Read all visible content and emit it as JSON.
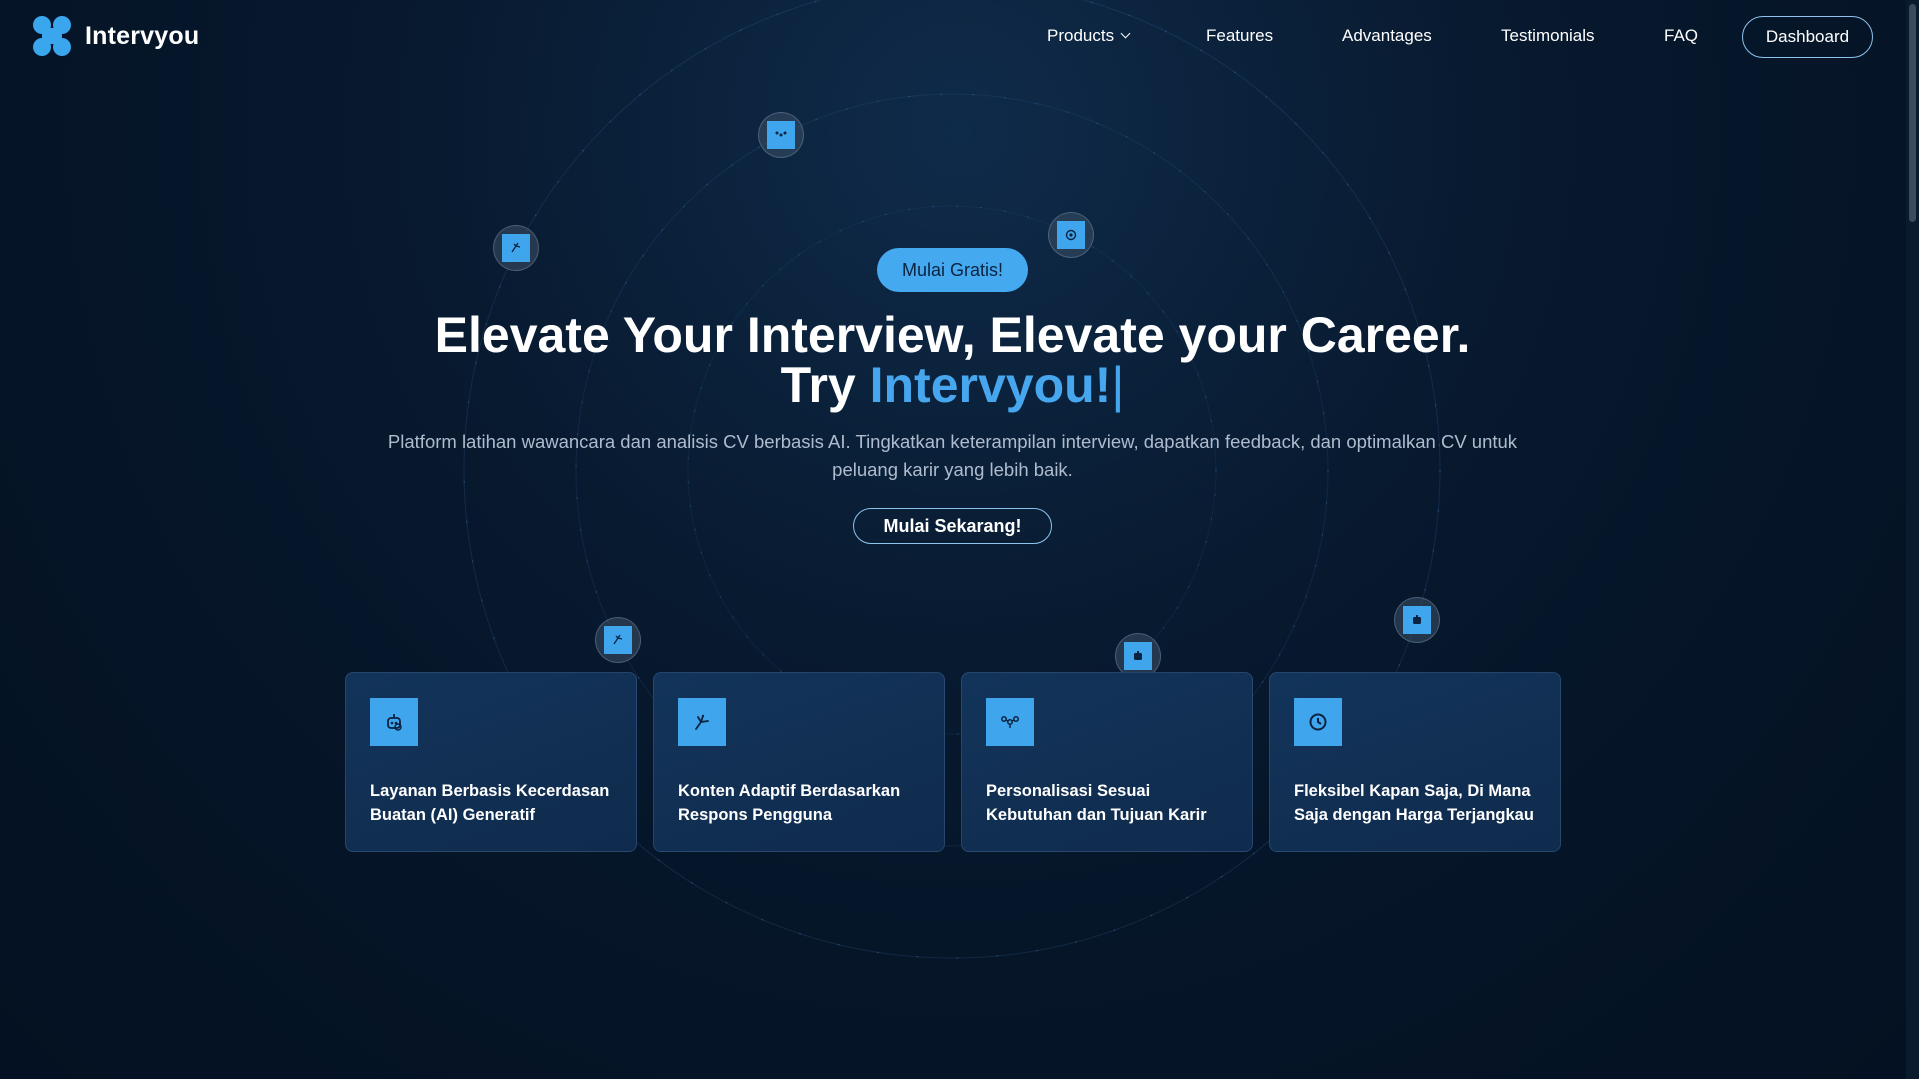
{
  "brand": {
    "name": "Intervyou",
    "accent": "#47a7ee"
  },
  "nav": {
    "items": [
      {
        "label": "Products",
        "has_dropdown": true
      },
      {
        "label": "Features"
      },
      {
        "label": "Advantages"
      },
      {
        "label": "Testimonials"
      },
      {
        "label": "FAQ"
      }
    ],
    "dashboard_label": "Dashboard"
  },
  "hero": {
    "badge": "Mulai Gratis!",
    "headline_line1": "Elevate Your Interview, Elevate your Career.",
    "headline_try": "Try",
    "headline_brand": "Intervyou!",
    "cursor": "|",
    "subtitle": "Platform latihan wawancara dan analisis CV berbasis AI. Tingkatkan keterampilan interview, dapatkan feedback, dan optimalkan CV untuk peluang karir yang lebih baik.",
    "cta_label": "Mulai Sekarang!"
  },
  "features": [
    {
      "icon": "robot-icon",
      "text": "Layanan Berbasis Kecerdasan Buatan (AI) Generatif"
    },
    {
      "icon": "adaptive-hand-icon",
      "text": "Konten Adaptif Berdasarkan Respons Pengguna"
    },
    {
      "icon": "people-network-icon",
      "text": "Personalisasi Sesuai Kebutuhan dan Tujuan Karir"
    },
    {
      "icon": "clock-icon",
      "text": "Fleksibel Kapan Saja, Di Mana Saja dengan Harga Terjangkau"
    }
  ],
  "orbit_icons": [
    "adaptive-hand-icon",
    "people-network-icon",
    "clock-icon",
    "adaptive-hand-icon",
    "robot-icon",
    "robot-icon"
  ]
}
